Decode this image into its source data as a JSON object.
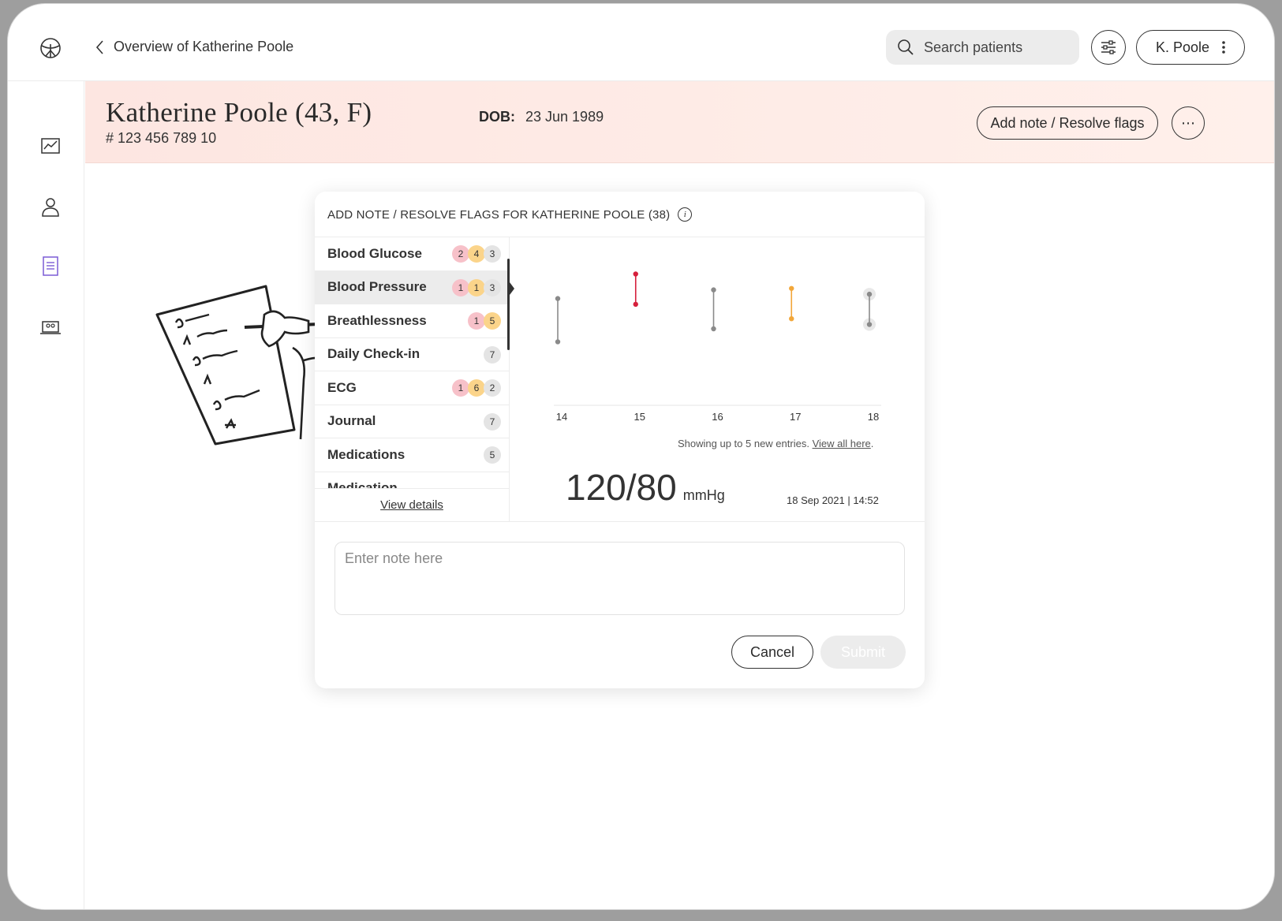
{
  "topbar": {
    "back_label": "Overview of Katherine Poole",
    "search_placeholder": "Search patients",
    "user_label": "K. Poole"
  },
  "patient": {
    "name": "Katherine Poole (43, F)",
    "id": "# 123 456 789 10",
    "dob_label": "DOB:",
    "dob_value": "23 Jun 1989"
  },
  "header_actions": {
    "add_note_label": "Add note / Resolve flags",
    "more_label": "⋯"
  },
  "modal": {
    "title": "ADD NOTE / RESOLVE FLAGS FOR KATHERINE POOLE (38)",
    "info_glyph": "i",
    "categories": [
      {
        "label": "Blood Glucose",
        "red": "2",
        "amber": "4",
        "grey": "3"
      },
      {
        "label": "Blood Pressure",
        "red": "1",
        "amber": "1",
        "grey": "3"
      },
      {
        "label": "Breathlessness",
        "red": "1",
        "amber": "5",
        "grey": ""
      },
      {
        "label": "Daily Check-in",
        "red": "",
        "amber": "",
        "grey": "7"
      },
      {
        "label": "ECG",
        "red": "1",
        "amber": "6",
        "grey": "2"
      },
      {
        "label": "Journal",
        "red": "",
        "amber": "",
        "grey": "7"
      },
      {
        "label": "Medications",
        "red": "",
        "amber": "",
        "grey": "5"
      },
      {
        "label": "Medication",
        "red": "",
        "amber": "",
        "grey": ""
      }
    ],
    "view_details": "View details",
    "chart_note_prefix": "Showing up to 5 new entries. ",
    "chart_note_link": "View all here",
    "chart_note_suffix": ".",
    "reading_value": "120/80",
    "reading_unit": "mmHg",
    "reading_date": "18 Sep 2021 | 14:52",
    "note_placeholder": "Enter note here",
    "cancel_label": "Cancel",
    "submit_label": "Submit"
  },
  "chart_data": {
    "type": "range",
    "categories": [
      "14",
      "15",
      "16",
      "17",
      "18"
    ],
    "series": [
      {
        "x": "14",
        "high": 0.74,
        "low": 0.44,
        "status": "normal"
      },
      {
        "x": "15",
        "high": 0.91,
        "low": 0.7,
        "status": "red"
      },
      {
        "x": "16",
        "high": 0.8,
        "low": 0.53,
        "status": "normal"
      },
      {
        "x": "17",
        "high": 0.81,
        "low": 0.6,
        "status": "amber"
      },
      {
        "x": "18",
        "high": 0.77,
        "low": 0.56,
        "status": "selected"
      }
    ],
    "colors": {
      "normal": "#8a8a8a",
      "red": "#d6203c",
      "amber": "#f2a73a",
      "selected": "#8a8a8a"
    },
    "grid": false
  },
  "colors": {
    "header_band": "#fde6e1",
    "badge_red": "#f7c1c9",
    "badge_amber": "#fbd48a",
    "badge_grey": "#e4e4e4",
    "accent_purple": "#7b5cd6"
  }
}
